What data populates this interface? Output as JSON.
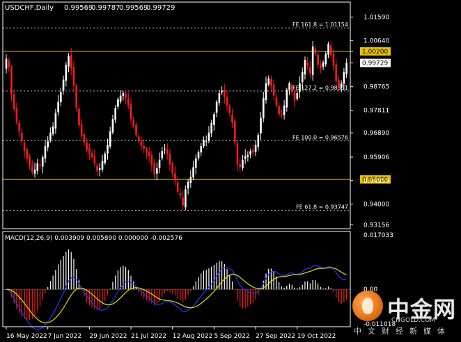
{
  "chart_data": {
    "type": "candlestick",
    "symbol": "USDCHF,Daily",
    "ohlc_values": [
      "0.99569",
      "0.99787",
      "0.99569",
      "0.99729"
    ],
    "y_ticks": [
      0.93156,
      0.94,
      0.94953,
      0.95906,
      0.9689,
      0.97811,
      0.98765,
      0.99729,
      1.002,
      1.0064,
      1.0159
    ],
    "y_tick_labels": [
      "0.93156",
      "0.94000",
      "0.94953",
      "0.95906",
      "0.96890",
      "0.97811",
      "0.98765",
      "",
      "",
      "1.00640",
      "1.01590"
    ],
    "ylim": [
      0.93,
      1.022
    ],
    "x_labels": [
      "16 May 2022",
      "7 Jun 2022",
      "29 Jun 2022",
      "21 Jul 2022",
      "12 Aug 2022",
      "5 Sep 2022",
      "27 Sep 2022",
      "19 Oct 2022"
    ],
    "x_label_index": [
      0,
      16,
      32,
      48,
      64,
      80,
      96,
      112
    ],
    "current_price": {
      "value": 0.99729,
      "label": "0.99729"
    },
    "levels": [
      {
        "value": 1.002,
        "label": "1.00200",
        "color": "#e8c000"
      },
      {
        "value": 0.95,
        "label": "0.95000",
        "color": "#e8c000"
      }
    ],
    "fib_levels": [
      {
        "value": 1.01154,
        "label": "FE 161.8 = 1.01154"
      },
      {
        "value": 0.98591,
        "label": "FE 127.2 = 0.98591"
      },
      {
        "value": 0.96576,
        "label": "FE 100.0 = 0.96576"
      },
      {
        "value": 0.93747,
        "label": "FE 61.8 = 0.93747"
      }
    ],
    "closes": [
      0.999,
      0.9955,
      0.9845,
      0.9785,
      0.973,
      0.9695,
      0.9655,
      0.9615,
      0.9585,
      0.9555,
      0.953,
      0.954,
      0.9565,
      0.9555,
      0.959,
      0.9635,
      0.9655,
      0.969,
      0.9715,
      0.977,
      0.9815,
      0.9855,
      0.9905,
      0.9965,
      1.0,
      0.995,
      0.988,
      0.979,
      0.972,
      0.9675,
      0.965,
      0.962,
      0.9605,
      0.959,
      0.9565,
      0.9535,
      0.9545,
      0.9575,
      0.9605,
      0.964,
      0.9695,
      0.9745,
      0.979,
      0.9825,
      0.984,
      0.985,
      0.983,
      0.98,
      0.9745,
      0.9715,
      0.968,
      0.9655,
      0.9635,
      0.9625,
      0.961,
      0.9595,
      0.956,
      0.952,
      0.9545,
      0.958,
      0.9615,
      0.9625,
      0.9605,
      0.956,
      0.9525,
      0.9495,
      0.945,
      0.9435,
      0.9395,
      0.946,
      0.949,
      0.951,
      0.955,
      0.9585,
      0.961,
      0.9635,
      0.966,
      0.9655,
      0.969,
      0.973,
      0.9765,
      0.9815,
      0.985,
      0.986,
      0.9835,
      0.98,
      0.977,
      0.973,
      0.965,
      0.956,
      0.955,
      0.958,
      0.9595,
      0.96,
      0.9615,
      0.961,
      0.964,
      0.968,
      0.975,
      0.983,
      0.989,
      0.991,
      0.988,
      0.984,
      0.98,
      0.9765,
      0.976,
      0.98,
      0.9865,
      0.989,
      0.9855,
      0.982,
      0.985,
      0.989,
      0.9935,
      0.9985,
      0.996,
      0.993,
      1.004,
      1.001,
      0.9965,
      0.995,
      0.9975,
      1.001,
      1.005,
      1.0005,
      0.996,
      0.99,
      0.987,
      0.989,
      0.9935,
      0.9973
    ],
    "macd": {
      "label": "MACD(12,26,9) 0.003909 0.005890 0.000000 -0.002576",
      "y_tick_labels": [
        "0.017033",
        "0.00",
        "-0.011018"
      ],
      "ylim": [
        -0.011018,
        0.017033
      ],
      "signal_color": "#e8e000",
      "main_color": "#1e3cff"
    }
  }
}
